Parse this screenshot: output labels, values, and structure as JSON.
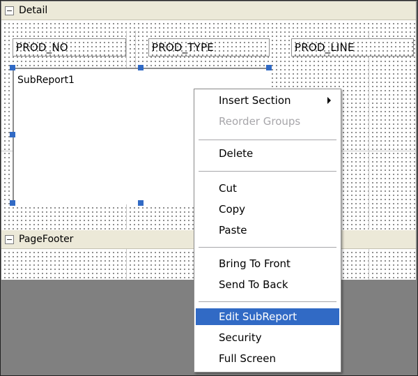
{
  "sections": {
    "detail": {
      "label": "Detail"
    },
    "page_footer": {
      "label": "PageFooter"
    }
  },
  "fields": [
    {
      "text": "PROD_NO"
    },
    {
      "text": "PROD_TYPE"
    },
    {
      "text": "PROD_LINE"
    }
  ],
  "subreport": {
    "label": "SubReport1"
  },
  "context_menu": {
    "items": [
      {
        "label": "Insert Section",
        "state": "normal",
        "has_submenu": true
      },
      {
        "label": "Reorder Groups",
        "state": "disabled"
      },
      {
        "label": "Delete",
        "state": "normal"
      },
      {
        "label": "Cut",
        "state": "normal"
      },
      {
        "label": "Copy",
        "state": "normal"
      },
      {
        "label": "Paste",
        "state": "normal"
      },
      {
        "label": "Bring To Front",
        "state": "normal"
      },
      {
        "label": "Send To Back",
        "state": "normal"
      },
      {
        "label": "Edit SubReport",
        "state": "selected"
      },
      {
        "label": "Security",
        "state": "normal"
      },
      {
        "label": "Full Screen",
        "state": "normal"
      }
    ]
  },
  "colors": {
    "selection": "#316ac5",
    "section_header": "#ece9d8",
    "background": "#808080"
  },
  "icons": {
    "collapse": "minus-box-icon",
    "submenu": "chevron-right-icon",
    "resize_handle": "square-handle"
  }
}
